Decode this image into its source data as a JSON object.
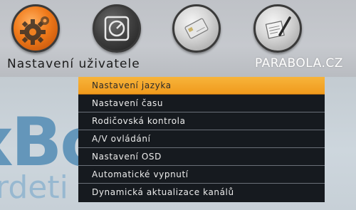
{
  "header": {
    "icons": [
      {
        "name": "settings-gear-icon",
        "state": "selected"
      },
      {
        "name": "clock-icon",
        "state": "normal"
      },
      {
        "name": "card-icon",
        "state": "normal"
      },
      {
        "name": "notes-pen-icon",
        "state": "normal"
      }
    ],
    "section_title": "Nastavení uživatele",
    "watermark": "PARABOLA.CZ"
  },
  "menu": {
    "items": [
      {
        "label": "Nastavení jazyka"
      },
      {
        "label": "Nastavení času"
      },
      {
        "label": "Rodičovská kontrola"
      },
      {
        "label": "A/V ovládání"
      },
      {
        "label": "Nastavení OSD"
      },
      {
        "label": "Automatické vypnutí"
      },
      {
        "label": "Dynamická aktualizace kanálů"
      }
    ],
    "selected_index": 0
  },
  "background": {
    "logo_text": "xBox",
    "logo_subtext": "rdeti",
    "highlight_color": "#f4a82a",
    "menu_bg_color": "#161a1f",
    "logo_color": "#5f93b9"
  }
}
